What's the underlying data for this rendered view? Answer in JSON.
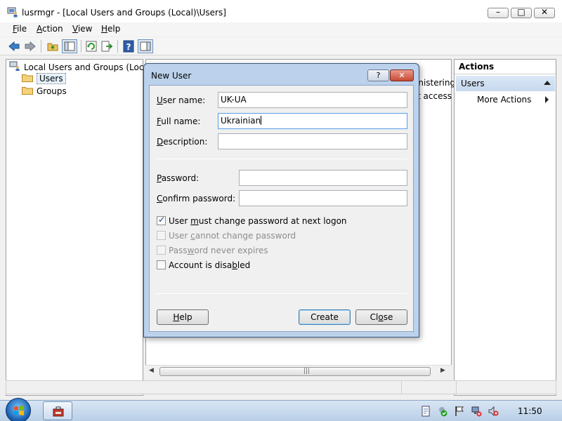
{
  "window": {
    "title": "lusrmgr - [Local Users and Groups (Local)\\Users]",
    "buttons": {
      "minimize": "–",
      "maximize": "□",
      "close": "✕"
    }
  },
  "menu": [
    {
      "pre": "",
      "accel": "F",
      "post": "ile"
    },
    {
      "pre": "",
      "accel": "A",
      "post": "ction"
    },
    {
      "pre": "",
      "accel": "V",
      "post": "iew"
    },
    {
      "pre": "",
      "accel": "H",
      "post": "elp"
    }
  ],
  "tree": {
    "root": "Local Users and Groups (Local)",
    "users": "Users",
    "groups": "Groups"
  },
  "center": {
    "fragment1": "inistering",
    "fragment2": "t access t"
  },
  "actions": {
    "title": "Actions",
    "group": "Users",
    "more": "More Actions"
  },
  "dialog": {
    "title": "New User",
    "help_glyph": "?",
    "close_glyph": "✕",
    "fields": {
      "user_name": {
        "pre": "",
        "accel": "U",
        "post": "ser name:",
        "value": "UK-UA"
      },
      "full_name": {
        "pre": "",
        "accel": "F",
        "post": "ull name:",
        "value": "Ukrainian"
      },
      "description": {
        "pre": "",
        "accel": "D",
        "post": "escription:",
        "value": ""
      },
      "password": {
        "pre": "",
        "accel": "P",
        "post": "assword:",
        "value": ""
      },
      "confirm": {
        "pre": "",
        "accel": "C",
        "post": "onfirm password:",
        "value": ""
      }
    },
    "checkboxes": {
      "must_change": {
        "pre": "User ",
        "accel": "m",
        "post": "ust change password at next logon",
        "checked": true,
        "enabled": true
      },
      "cannot_change": {
        "pre": "User ",
        "accel": "c",
        "post": "annot change password",
        "checked": false,
        "enabled": false
      },
      "never_expires": {
        "pre": "Pass",
        "accel": "w",
        "post": "ord never expires",
        "checked": false,
        "enabled": false
      },
      "disabled": {
        "pre": "Account is disa",
        "accel": "b",
        "post": "led",
        "checked": false,
        "enabled": true
      }
    },
    "buttons": {
      "help": {
        "pre": "",
        "accel": "H",
        "post": "elp"
      },
      "create": {
        "pre": "",
        "accel": "",
        "post": "Create"
      },
      "close": {
        "pre": "Cl",
        "accel": "o",
        "post": "se"
      }
    }
  },
  "taskbar": {
    "clock": "11:50"
  },
  "colors": {
    "dialog_frame": "#bcd2ec",
    "actions_header": "#c7d9ee",
    "close_button": "#c74a34",
    "taskbar": "#b9cfe6"
  },
  "icons": {
    "app": "computer-users-icon",
    "back": "back-arrow-icon",
    "forward": "forward-arrow-icon",
    "up": "up-folder-icon",
    "show_hide_tree": "console-tree-icon",
    "refresh": "refresh-icon",
    "export": "export-list-icon",
    "help": "help-icon",
    "action_pane": "action-pane-icon",
    "folder": "folder-icon",
    "start": "windows-start-icon"
  }
}
